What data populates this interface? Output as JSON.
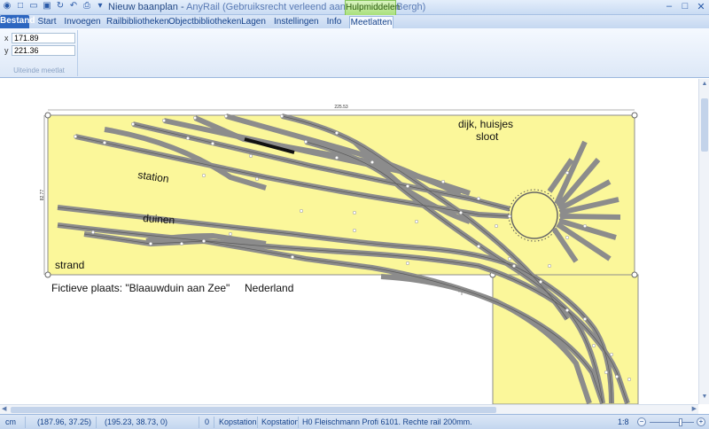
{
  "titlebar": {
    "doc_title": "Nieuw baanplan",
    "separator": " - ",
    "app_name": "AnyRail (Gebruiksrecht verleend aan M van den Bergh)",
    "context_tab": "Hulpmiddelen"
  },
  "tabs": [
    "Bestand",
    "Start",
    "Invoegen",
    "Railbibliotheken",
    "Objectbibliotheken",
    "Lagen",
    "Instellingen",
    "Info",
    "Meetlatten"
  ],
  "ribbon": {
    "x_label": "x",
    "x_value": "171.89",
    "y_label": "y",
    "y_value": "221.36",
    "group_label": "Uiteinde meetlat"
  },
  "canvas": {
    "dimension_top": "225.53",
    "dimension_left": "82.77",
    "labels": {
      "dijk": "dijk, huisjes",
      "sloot": "sloot",
      "station": "station",
      "duinen": "duinen",
      "strand": "strand",
      "plaats": "Fictieve plaats: \"Blaauwduin aan Zee\"",
      "land": "Nederland"
    },
    "colors": {
      "board": "#fbf79a",
      "track": "#8c8c8c",
      "rail": "#5a5a5a",
      "selected": "#111111"
    }
  },
  "statusbar": {
    "unit": "cm",
    "coords1": "(187.96, 37.25)",
    "coords2": "(195.23, 38.73, 0)",
    "count": "0",
    "layer1": "Kopstation",
    "layer2": "Kopstation",
    "info": "H0 Fleischmann Profi 6101. Rechte rail 200mm.",
    "scale": "1:8"
  }
}
